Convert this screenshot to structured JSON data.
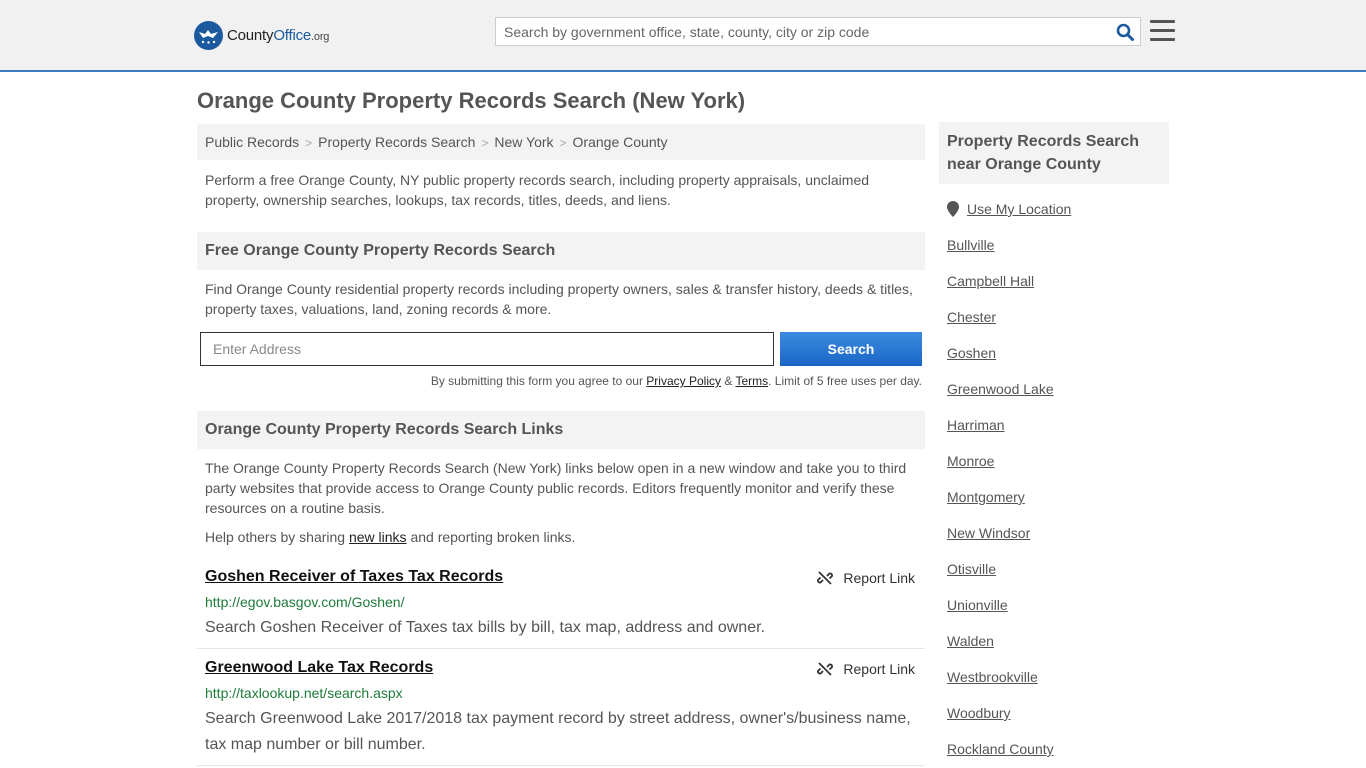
{
  "header": {
    "logo_name": "County",
    "logo_brand": "Office",
    "logo_tld": ".org",
    "search_placeholder": "Search by government office, state, county, city or zip code"
  },
  "page_title": "Orange County Property Records Search (New York)",
  "breadcrumb": [
    "Public Records",
    "Property Records Search",
    "New York",
    "Orange County"
  ],
  "intro": "Perform a free Orange County, NY public property records search, including property appraisals, unclaimed property, ownership searches, lookups, tax records, titles, deeds, and liens.",
  "free_search": {
    "heading": "Free Orange County Property Records Search",
    "text": "Find Orange County residential property records including property owners, sales & transfer history, deeds & titles, property taxes, valuations, land, zoning records & more.",
    "address_placeholder": "Enter Address",
    "button_label": "Search",
    "terms_prefix": "By submitting this form you agree to our",
    "privacy_label": "Privacy Policy",
    "amp": "&",
    "terms_label": "Terms",
    "terms_suffix": ". Limit of 5 free uses per day."
  },
  "links_section": {
    "heading": "Orange County Property Records Search Links",
    "text": "The Orange County Property Records Search (New York) links below open in a new window and take you to third party websites that provide access to Orange County public records. Editors frequently monitor and verify these resources on a routine basis.",
    "help_prefix": "Help others by sharing",
    "help_link": "new links",
    "help_suffix": "and reporting broken links.",
    "items": [
      {
        "title": "Goshen Receiver of Taxes Tax Records",
        "report_label": "Report Link",
        "url": "http://egov.basgov.com/Goshen/",
        "desc": "Search Goshen Receiver of Taxes tax bills by bill, tax map, address and owner."
      },
      {
        "title": "Greenwood Lake Tax Records",
        "report_label": "Report Link",
        "url": "http://taxlookup.net/search.aspx",
        "desc": "Search Greenwood Lake 2017/2018 tax payment record by street address, owner's/business name, tax map number or bill number."
      }
    ]
  },
  "sidebar": {
    "heading": "Property Records Search near Orange County",
    "use_location": "Use My Location",
    "places": [
      "Bullville",
      "Campbell Hall",
      "Chester",
      "Goshen",
      "Greenwood Lake",
      "Harriman",
      "Monroe",
      "Montgomery",
      "New Windsor",
      "Otisville",
      "Unionville",
      "Walden",
      "Westbrookville",
      "Woodbury",
      "Rockland County"
    ]
  }
}
